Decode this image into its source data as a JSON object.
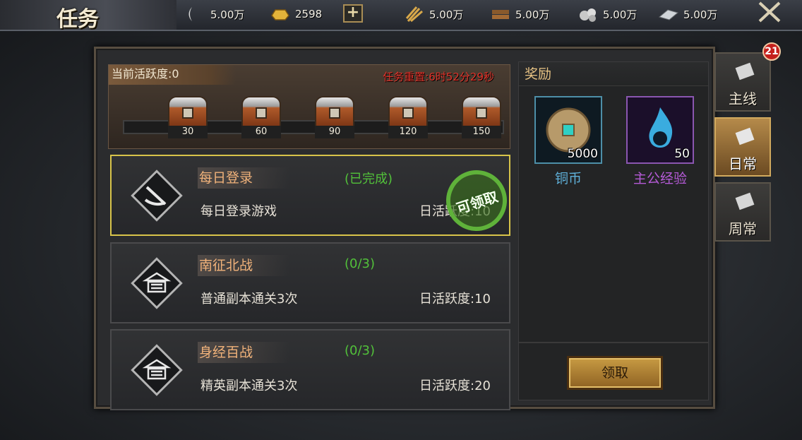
{
  "header": {
    "title": "任务",
    "resources": [
      {
        "icon": "moon-blade-icon",
        "value": "5.00万"
      },
      {
        "icon": "gold-ingot-icon",
        "value": "2598"
      },
      {
        "icon": "grain-icon",
        "value": "5.00万"
      },
      {
        "icon": "wood-icon",
        "value": "5.00万"
      },
      {
        "icon": "stone-icon",
        "value": "5.00万"
      },
      {
        "icon": "iron-icon",
        "value": "5.00万"
      }
    ],
    "plus_label": "+",
    "close_icon": "crossed-swords-close-icon"
  },
  "activity": {
    "label": "当前活跃度:0",
    "reset": "任务重置:6时52分29秒",
    "chests": [
      "30",
      "60",
      "90",
      "120",
      "150"
    ]
  },
  "tasks": [
    {
      "name": "每日登录",
      "progress": "(已完成)",
      "desc": "每日登录游戏",
      "points": "日活跃度:10",
      "icon": "sword-icon",
      "claimable": true,
      "stamp": "可领取"
    },
    {
      "name": "南征北战",
      "progress": "(0/3)",
      "desc": "普通副本通关3次",
      "points": "日活跃度:10",
      "icon": "pavilion-icon",
      "claimable": false
    },
    {
      "name": "身经百战",
      "progress": "(0/3)",
      "desc": "精英副本通关3次",
      "points": "日活跃度:20",
      "icon": "pavilion-icon",
      "claimable": false
    }
  ],
  "rewards": {
    "title": "奖励",
    "items": [
      {
        "name": "铜币",
        "count": "5000",
        "color": "#5fb0d9",
        "icon": "copper-coin-icon"
      },
      {
        "name": "主公经验",
        "count": "50",
        "color": "#b45ad6",
        "icon": "blue-flame-icon"
      }
    ],
    "claim_label": "领取"
  },
  "side_tabs": [
    {
      "label": "主线",
      "selected": false,
      "icon": "scroll-icon"
    },
    {
      "label": "日常",
      "selected": true,
      "icon": "scroll-icon"
    },
    {
      "label": "周常",
      "selected": false,
      "icon": "scroll-icon"
    }
  ],
  "badge": "21"
}
